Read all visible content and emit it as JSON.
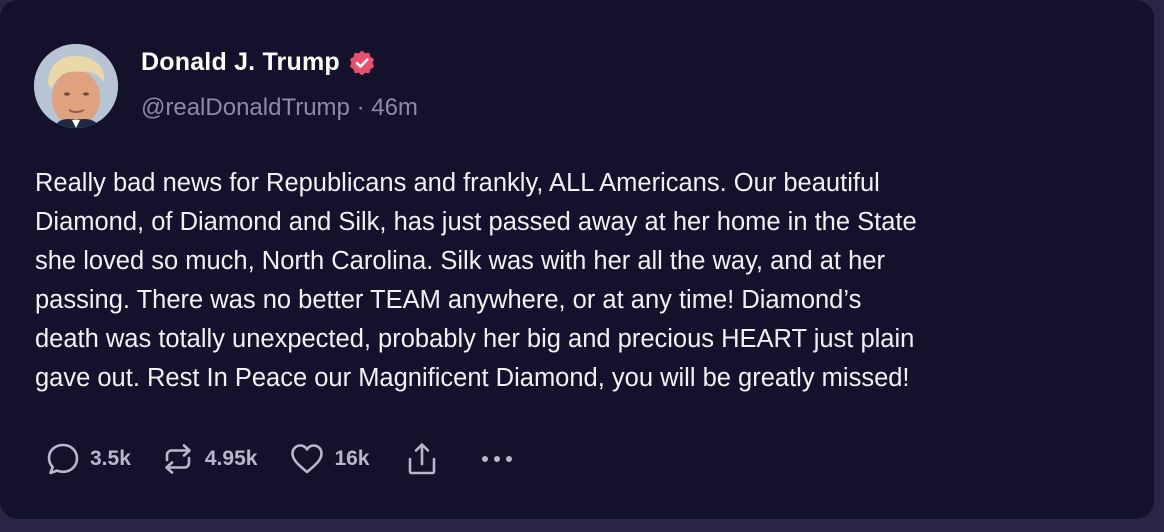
{
  "post": {
    "author_name": "Donald J. Trump",
    "handle": "@realDonaldTrump",
    "separator": "·",
    "time": "46m",
    "body_lines": [
      "Really bad news for Republicans and frankly, ALL Americans. Our beautiful",
      "Diamond, of Diamond and Silk, has just passed away at her home in the State",
      "she loved so much, North Carolina. Silk was with her all the way, and at her",
      "passing. There was no better TEAM anywhere, or at any time! Diamond’s",
      "death was totally unexpected, probably her big and precious HEART just plain",
      "gave out. Rest In Peace our Magnificent Diamond, you will be greatly missed!"
    ]
  },
  "actions": {
    "replies": "3.5k",
    "reposts": "4.95k",
    "likes": "16k",
    "reply_icon": "reply-icon",
    "repost_icon": "repost-icon",
    "like_icon": "heart-icon",
    "share_icon": "share-icon",
    "more_icon": "more-icon"
  },
  "colors": {
    "card_bg": "#13112b",
    "page_bg": "#2a2544",
    "verified_badge": "#e8506f",
    "text_primary": "#f2f1f7",
    "text_secondary": "#8d8aa6"
  }
}
